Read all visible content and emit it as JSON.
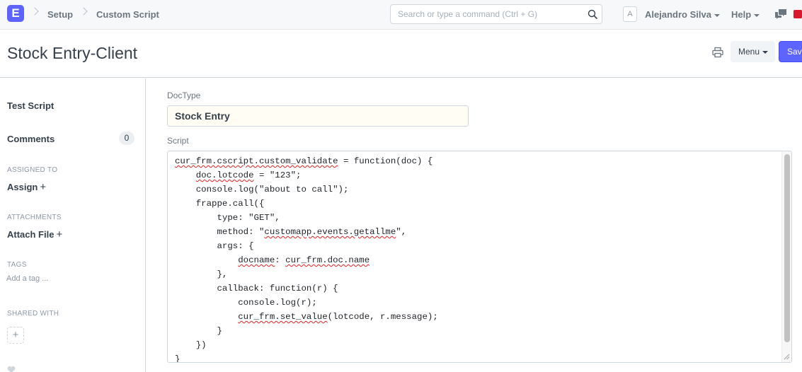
{
  "navbar": {
    "logo_letter": "E",
    "breadcrumbs": [
      "Setup",
      "Custom Script"
    ],
    "search_placeholder": "Search or type a command (Ctrl + G)",
    "avatar_letter": "A",
    "user_name": "Alejandro Silva",
    "help_label": "Help",
    "icons": [
      "search-icon",
      "comments-icon",
      "notification-indicator"
    ]
  },
  "page": {
    "title": "Stock Entry-Client",
    "menu_label": "Menu",
    "save_label": "Save",
    "icons": [
      "printer-icon",
      "caret-down-icon"
    ],
    "accent_color": "#5e64ff"
  },
  "sidebar": {
    "test_script": "Test Script",
    "comments_label": "Comments",
    "comments_count": "0",
    "assigned_to_heading": "ASSIGNED TO",
    "assign_label": "Assign",
    "attachments_heading": "ATTACHMENTS",
    "attach_label": "Attach File",
    "tags_heading": "TAGS",
    "add_tag_label": "Add a tag ...",
    "shared_with_heading": "SHARED WITH",
    "icons": [
      "plus-icon",
      "heart-icon"
    ]
  },
  "form": {
    "doctype_label": "DocType",
    "doctype_value": "Stock Entry",
    "script_label": "Script",
    "script_lines": [
      [
        {
          "t": "cur_frm.cscript.custom_validate",
          "sq": true
        },
        {
          "t": " = function(doc) {"
        }
      ],
      [
        {
          "t": "    "
        },
        {
          "t": "doc.lotcode",
          "sq": true
        },
        {
          "t": " = \"123\";"
        }
      ],
      [
        {
          "t": "    console.log(\"about to call\");"
        }
      ],
      [
        {
          "t": "    frappe.call({"
        }
      ],
      [
        {
          "t": "        type: \"GET\","
        }
      ],
      [
        {
          "t": "        method: \""
        },
        {
          "t": "customapp.events.getallme",
          "sq": true
        },
        {
          "t": "\","
        }
      ],
      [
        {
          "t": "        args: {"
        }
      ],
      [
        {
          "t": "            "
        },
        {
          "t": "docname",
          "sq": true
        },
        {
          "t": ": "
        },
        {
          "t": "cur_frm.doc.name",
          "sq": true
        }
      ],
      [
        {
          "t": "        },"
        }
      ],
      [
        {
          "t": "        callback: function(r) {"
        }
      ],
      [
        {
          "t": "            console.log(r);"
        }
      ],
      [
        {
          "t": "            "
        },
        {
          "t": "cur_frm.set_value",
          "sq": true
        },
        {
          "t": "(lotcode, r.message);"
        }
      ],
      [
        {
          "t": "        }"
        }
      ],
      [
        {
          "t": "    })"
        }
      ],
      [
        {
          "t": "}"
        }
      ]
    ]
  }
}
